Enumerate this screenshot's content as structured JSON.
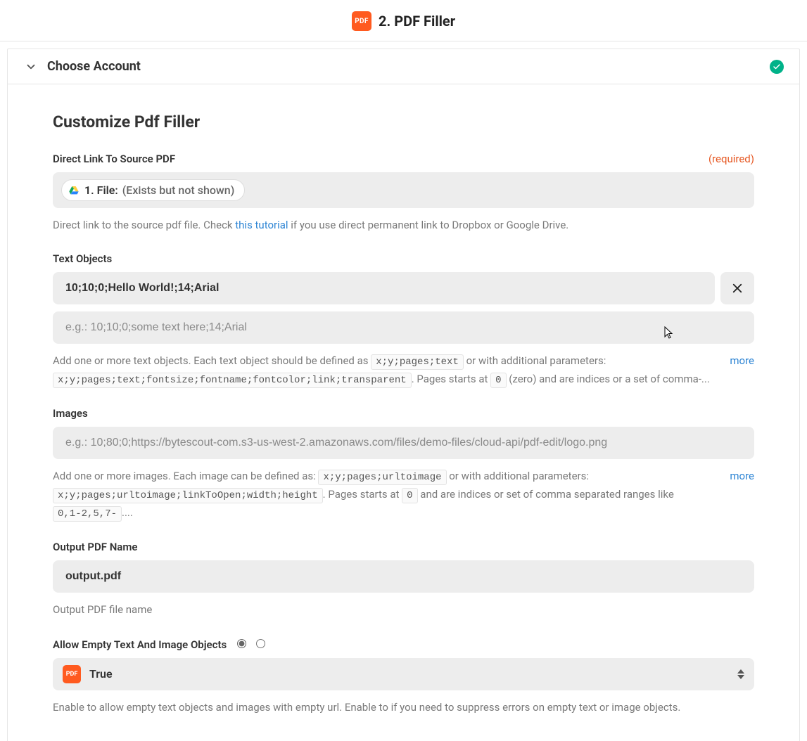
{
  "header": {
    "title": "2. PDF Filler",
    "icon_text": "PDF"
  },
  "account": {
    "title": "Choose Account"
  },
  "section": {
    "title": "Customize Pdf Filler"
  },
  "source_pdf": {
    "label": "Direct Link To Source PDF",
    "required": "(required)",
    "pill_prefix": "1. File:",
    "pill_value": "(Exists but not shown)",
    "help_before": "Direct link to the source pdf file. Check ",
    "help_link": "this tutorial",
    "help_after": " if you use direct permanent link to Dropbox or Google Drive."
  },
  "text_objects": {
    "label": "Text Objects",
    "value1": "10;10;0;Hello World!;14;Arial",
    "placeholder": "e.g.: 10;10;0;some text here;14;Arial",
    "help_a": "Add one or more text objects. Each text object should be defined as ",
    "code_a": "x;y;pages;text",
    "help_b": " or with additional parameters: ",
    "code_b": "x;y;pages;text;fontsize;fontname;fontcolor;link;transparent",
    "help_c": ". Pages starts at ",
    "code_zero": "0",
    "help_d": " (zero) and are indices or a set of comma-...",
    "more": "more"
  },
  "images": {
    "label": "Images",
    "placeholder": "e.g.: 10;80;0;https://bytescout-com.s3-us-west-2.amazonaws.com/files/demo-files/cloud-api/pdf-edit/logo.png",
    "help_a": "Add one or more images. Each image can be defined as: ",
    "code_a": "x;y;pages;urltoimage",
    "help_b": " or with additional parameters: ",
    "code_b": "x;y;pages;urltoimage;linkToOpen;width;height",
    "help_c": ". Pages starts at ",
    "code_zero": "0",
    "help_d": " and are indices or set of comma separated ranges like ",
    "code_range": "0,1-2,5,7-",
    "help_e": "....",
    "more": "more"
  },
  "output_name": {
    "label": "Output PDF Name",
    "value": "output.pdf",
    "help": "Output PDF file name"
  },
  "allow_empty": {
    "label": "Allow Empty Text And Image Objects",
    "value": "True",
    "help": "Enable to allow empty text objects and images with empty url. Enable to if you need to suppress errors on empty text or image objects."
  },
  "icon_labels": {
    "pdf_small": "PDF"
  }
}
